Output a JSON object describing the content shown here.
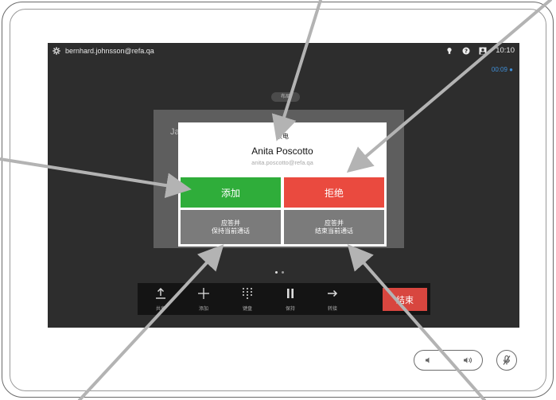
{
  "status_bar": {
    "account": "bernhard.johnsson@refa.qa",
    "time": "10:10",
    "call_timer": "00:09",
    "icons": [
      "gear-icon",
      "lightbulb-icon",
      "help-icon",
      "selfview-icon"
    ]
  },
  "call_chip": "布局",
  "caller_card": {
    "initials": "Ja"
  },
  "incoming_dialog": {
    "subtitle": "来电",
    "caller_name": "Anita Poscotto",
    "caller_email": "anita.poscotto@refa.qa",
    "accept_label": "添加",
    "decline_label": "拒绝",
    "answer_hold_line1": "应答并",
    "answer_hold_line2": "保持当前通话",
    "answer_end_line1": "应答并",
    "answer_end_line2": "结束当前通话",
    "colors": {
      "accept": "#2fad3a",
      "decline": "#ea4a3f",
      "secondary": "#7b7b7b"
    }
  },
  "toolbar": {
    "items": [
      {
        "label": "共享",
        "icon": "share-icon"
      },
      {
        "label": "添加",
        "icon": "add-icon"
      },
      {
        "label": "键盘",
        "icon": "keypad-icon"
      },
      {
        "label": "保持",
        "icon": "pause-icon"
      },
      {
        "label": "转接",
        "icon": "transfer-icon"
      }
    ],
    "end_call_label": "结束",
    "end_call_color": "#d8463f"
  },
  "hardware": {
    "icons": [
      "volume-down-icon",
      "volume-up-icon",
      "mute-mic-icon"
    ]
  }
}
